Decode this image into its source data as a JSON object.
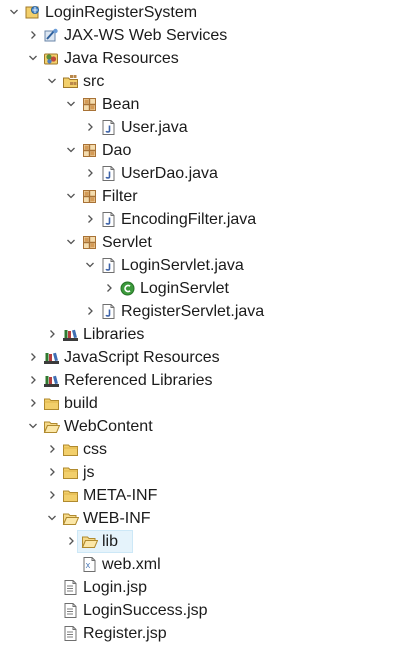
{
  "tree": {
    "items": [
      {
        "label": "LoginRegisterSystem",
        "depth": 0,
        "expander": "expanded",
        "icon": "web-project-icon"
      },
      {
        "label": "JAX-WS Web Services",
        "depth": 1,
        "expander": "collapsed",
        "icon": "web-services-icon"
      },
      {
        "label": "Java Resources",
        "depth": 1,
        "expander": "expanded",
        "icon": "java-resources-icon"
      },
      {
        "label": "src",
        "depth": 2,
        "expander": "expanded",
        "icon": "source-folder-icon"
      },
      {
        "label": "Bean",
        "depth": 3,
        "expander": "expanded",
        "icon": "package-icon"
      },
      {
        "label": "User.java",
        "depth": 4,
        "expander": "collapsed",
        "icon": "java-file-icon"
      },
      {
        "label": "Dao",
        "depth": 3,
        "expander": "expanded",
        "icon": "package-icon"
      },
      {
        "label": "UserDao.java",
        "depth": 4,
        "expander": "collapsed",
        "icon": "java-file-icon"
      },
      {
        "label": "Filter",
        "depth": 3,
        "expander": "expanded",
        "icon": "package-icon"
      },
      {
        "label": "EncodingFilter.java",
        "depth": 4,
        "expander": "collapsed",
        "icon": "java-file-icon"
      },
      {
        "label": "Servlet",
        "depth": 3,
        "expander": "expanded",
        "icon": "package-icon"
      },
      {
        "label": "LoginServlet.java",
        "depth": 4,
        "expander": "expanded",
        "icon": "java-file-icon"
      },
      {
        "label": "LoginServlet",
        "depth": 5,
        "expander": "collapsed",
        "icon": "class-icon"
      },
      {
        "label": "RegisterServlet.java",
        "depth": 4,
        "expander": "collapsed",
        "icon": "java-file-icon"
      },
      {
        "label": "Libraries",
        "depth": 2,
        "expander": "collapsed",
        "icon": "libraries-icon"
      },
      {
        "label": "JavaScript Resources",
        "depth": 1,
        "expander": "collapsed",
        "icon": "libraries-icon"
      },
      {
        "label": "Referenced Libraries",
        "depth": 1,
        "expander": "collapsed",
        "icon": "libraries-icon"
      },
      {
        "label": "build",
        "depth": 1,
        "expander": "collapsed",
        "icon": "folder-icon"
      },
      {
        "label": "WebContent",
        "depth": 1,
        "expander": "expanded",
        "icon": "folder-open-icon"
      },
      {
        "label": "css",
        "depth": 2,
        "expander": "collapsed",
        "icon": "folder-icon"
      },
      {
        "label": "js",
        "depth": 2,
        "expander": "collapsed",
        "icon": "folder-icon"
      },
      {
        "label": "META-INF",
        "depth": 2,
        "expander": "collapsed",
        "icon": "folder-icon"
      },
      {
        "label": "WEB-INF",
        "depth": 2,
        "expander": "expanded",
        "icon": "folder-open-icon"
      },
      {
        "label": "lib",
        "depth": 3,
        "expander": "collapsed",
        "icon": "folder-open-icon",
        "selected": true
      },
      {
        "label": "web.xml",
        "depth": 3,
        "expander": "none",
        "icon": "xml-file-icon"
      },
      {
        "label": "Login.jsp",
        "depth": 2,
        "expander": "none",
        "icon": "jsp-file-icon"
      },
      {
        "label": "LoginSuccess.jsp",
        "depth": 2,
        "expander": "none",
        "icon": "jsp-file-icon"
      },
      {
        "label": "Register.jsp",
        "depth": 2,
        "expander": "none",
        "icon": "jsp-file-icon"
      }
    ]
  },
  "colors": {
    "selection": "#e5f3fb",
    "chevron": "#5a5a5a",
    "folder": "#e8b24a",
    "package": "#b9874a",
    "class": "#3c9a3c"
  }
}
